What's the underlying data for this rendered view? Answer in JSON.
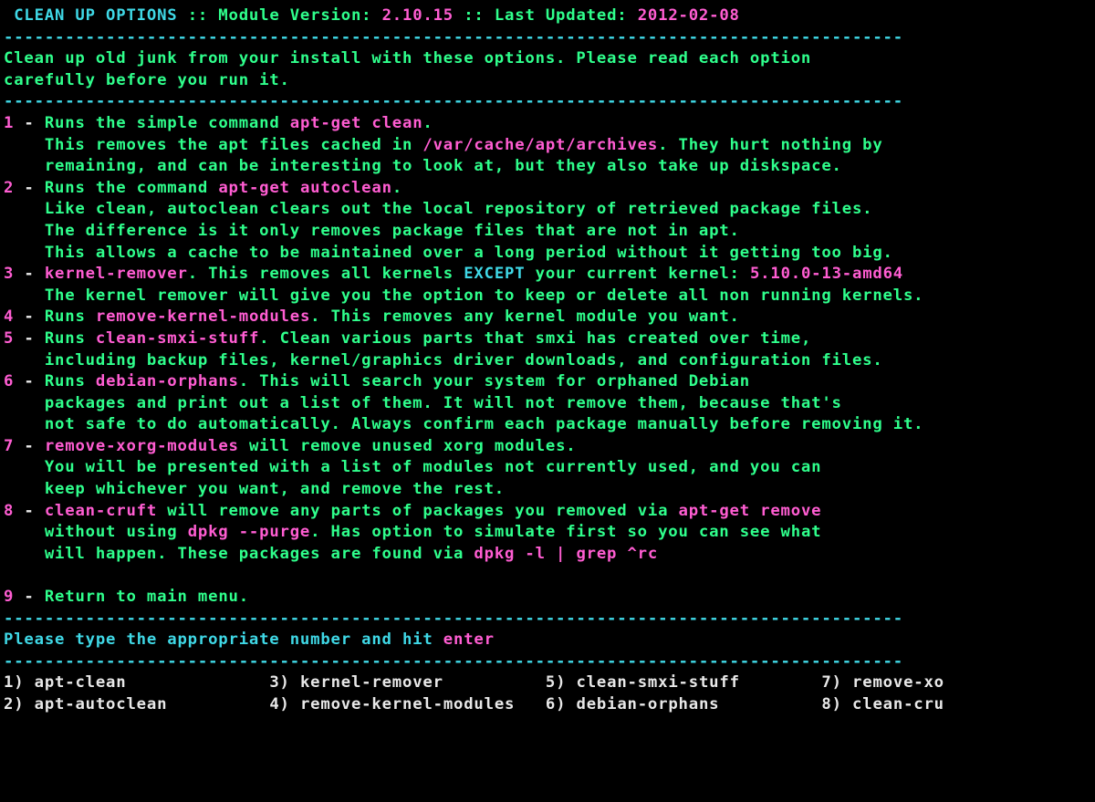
{
  "header": {
    "title": " CLEAN UP OPTIONS ",
    "sep1": ":: Module Version: ",
    "version": "2.10.15",
    "sep2": " :: Last Updated: ",
    "updated": "2012-02-08"
  },
  "dashes": "----------------------------------------------------------------------------------------",
  "intro1": "Clean up old junk from your install with these options. Please read each option",
  "intro2": "carefully before you run it.",
  "items": [
    {
      "n": "1",
      "a": "Runs the simple command ",
      "cmd": "apt-get clean",
      "tail": ".",
      "body": [
        {
          "pre": "    This removes the apt files cached in ",
          "cmd": "/var/cache/apt/archives",
          "tail": ". They hurt nothing by"
        },
        {
          "pre": "    remaining, and can be interesting to look at, but they also take up diskspace."
        }
      ]
    },
    {
      "n": "2",
      "a": "Runs the command ",
      "cmd": "apt-get autoclean",
      "tail": ".",
      "body": [
        {
          "pre": "    Like clean, autoclean clears out the local repository of retrieved package files."
        },
        {
          "pre": "    The difference is it only removes package files that are not in apt."
        },
        {
          "pre": "    This allows a cache to be maintained over a long period without it getting too big."
        }
      ]
    },
    {
      "n": "3",
      "cmd0": "kernel-remover",
      "a2": ". This removes all kernels ",
      "except": "EXCEPT",
      "a3": " your current kernel: ",
      "kver": "5.10.0-13-amd64",
      "body": [
        {
          "pre": "    The kernel remover will give you the option to keep or delete all non running kernels."
        }
      ]
    },
    {
      "n": "4",
      "a": "Runs ",
      "cmd": "remove-kernel-modules",
      "tail": ". This removes any kernel module you want."
    },
    {
      "n": "5",
      "a": "Runs ",
      "cmd": "clean-smxi-stuff",
      "tail": ". Clean various parts that smxi has created over time,",
      "body": [
        {
          "pre": "    including backup files, kernel/graphics driver downloads, and configuration files."
        }
      ]
    },
    {
      "n": "6",
      "a": "Runs ",
      "cmd": "debian-orphans",
      "tail": ". This will search your system for orphaned Debian",
      "body": [
        {
          "pre": "    packages and print out a list of them. It will not remove them, because that's"
        },
        {
          "pre": "    not safe to do automatically. Always confirm each package manually before removing it."
        }
      ]
    },
    {
      "n": "7",
      "cmd0": "remove-xorg-modules",
      "a2": " will remove unused xorg modules.",
      "body": [
        {
          "pre": "    You will be presented with a list of modules not currently used, and you can"
        },
        {
          "pre": "    keep whichever you want, and remove the rest."
        }
      ]
    },
    {
      "n": "8",
      "cmd0": "clean-cruft",
      "a2": " will remove any parts of packages you removed via ",
      "cmd2": "apt-get remove",
      "body": [
        {
          "pre": "    without using ",
          "cmd": "dpkg --purge",
          "tail": ". Has option to simulate first so you can see what"
        },
        {
          "pre": "    will happen. These packages are found via ",
          "cmd": "dpkg -l | grep ^rc"
        }
      ]
    }
  ],
  "return": {
    "n": "9",
    "text": "Return to main menu."
  },
  "prompt": {
    "a": "Please type the appropriate number and hit ",
    "enter": "enter"
  },
  "choices": {
    "c1n": "1)",
    "c1": " apt-clean",
    "c2n": "2)",
    "c2": " apt-autoclean",
    "c3n": "3)",
    "c3": " kernel-remover",
    "c4n": "4)",
    "c4": " remove-kernel-modules",
    "c5n": "5)",
    "c5": " clean-smxi-stuff",
    "c6n": "6)",
    "c6": " debian-orphans",
    "c7n": "7)",
    "c7": " remove-xo",
    "c8n": "8)",
    "c8": " clean-cru"
  }
}
